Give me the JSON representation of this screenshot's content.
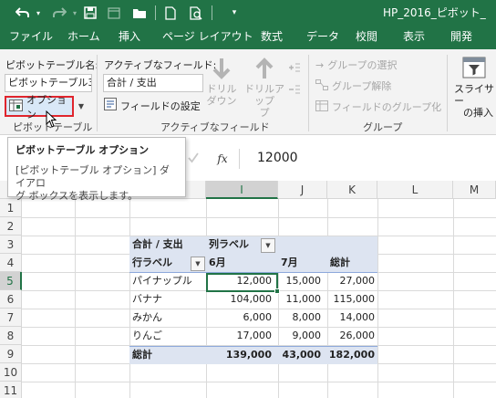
{
  "titlebar": {
    "doc_title": "HP_2016_ピボット_",
    "colors": {
      "brand": "#217346"
    },
    "qat_icons": [
      "undo-icon",
      "redo-icon",
      "save-icon",
      "calendar-icon",
      "folder-icon",
      "new-document-icon",
      "print-preview-icon",
      "customize-qat-icon"
    ]
  },
  "tabs": [
    "ファイル",
    "ホーム",
    "挿入",
    "ページ レイアウト",
    "数式",
    "データ",
    "校閲",
    "表示",
    "開発"
  ],
  "ribbon": {
    "pivot_name_label": "ピボットテーブル名:",
    "pivot_name_value": "ピボットテーブル3",
    "options_button": "オプション",
    "group_pivot_label": "ピボットテーブル",
    "active_field_label": "アクティブなフィールド:",
    "active_field_value": "合計 / 支出",
    "field_settings": "フィールドの設定",
    "drill_down_line1": "ドリル",
    "drill_down_line2": "ダウン",
    "drill_up_line1": "ドリルアップ",
    "drill_up_line2": "プ",
    "group_active_field_label": "アクティブなフィールド",
    "group_selection": "グループの選択",
    "ungroup": "グループ解除",
    "group_field": "フィールドのグループ化",
    "group_group_label": "グループ",
    "slicer_line1": "スライサー",
    "slicer_line2": "の挿入"
  },
  "tooltip": {
    "title": "ピボットテーブル オプション",
    "body_line1": "[ピボットテーブル オプション] ダイアロ",
    "body_line2": "グ ボックスを表示します。"
  },
  "formula_bar": {
    "fx": "fx",
    "value": "12000"
  },
  "columns": [
    "I",
    "J",
    "K",
    "L",
    "M"
  ],
  "rows": [
    "1",
    "2",
    "3",
    "4",
    "5",
    "6",
    "7",
    "8",
    "9",
    "10",
    "11"
  ],
  "pivot": {
    "header_sum": "合計 / 支出",
    "header_col_label": "列ラベル",
    "header_row_label": "行ラベル",
    "months": [
      "6月",
      "7月",
      "総計"
    ],
    "items": [
      {
        "name": "パイナップル",
        "jun": "12,000",
        "jul": "15,000",
        "total": "27,000"
      },
      {
        "name": "バナナ",
        "jun": "104,000",
        "jul": "11,000",
        "total": "115,000"
      },
      {
        "name": "みかん",
        "jun": "6,000",
        "jul": "8,000",
        "total": "14,000"
      },
      {
        "name": "りんご",
        "jun": "17,000",
        "jul": "9,000",
        "total": "26,000"
      }
    ],
    "grand_total": {
      "name": "総計",
      "jun": "139,000",
      "jul": "43,000",
      "total": "182,000"
    }
  }
}
